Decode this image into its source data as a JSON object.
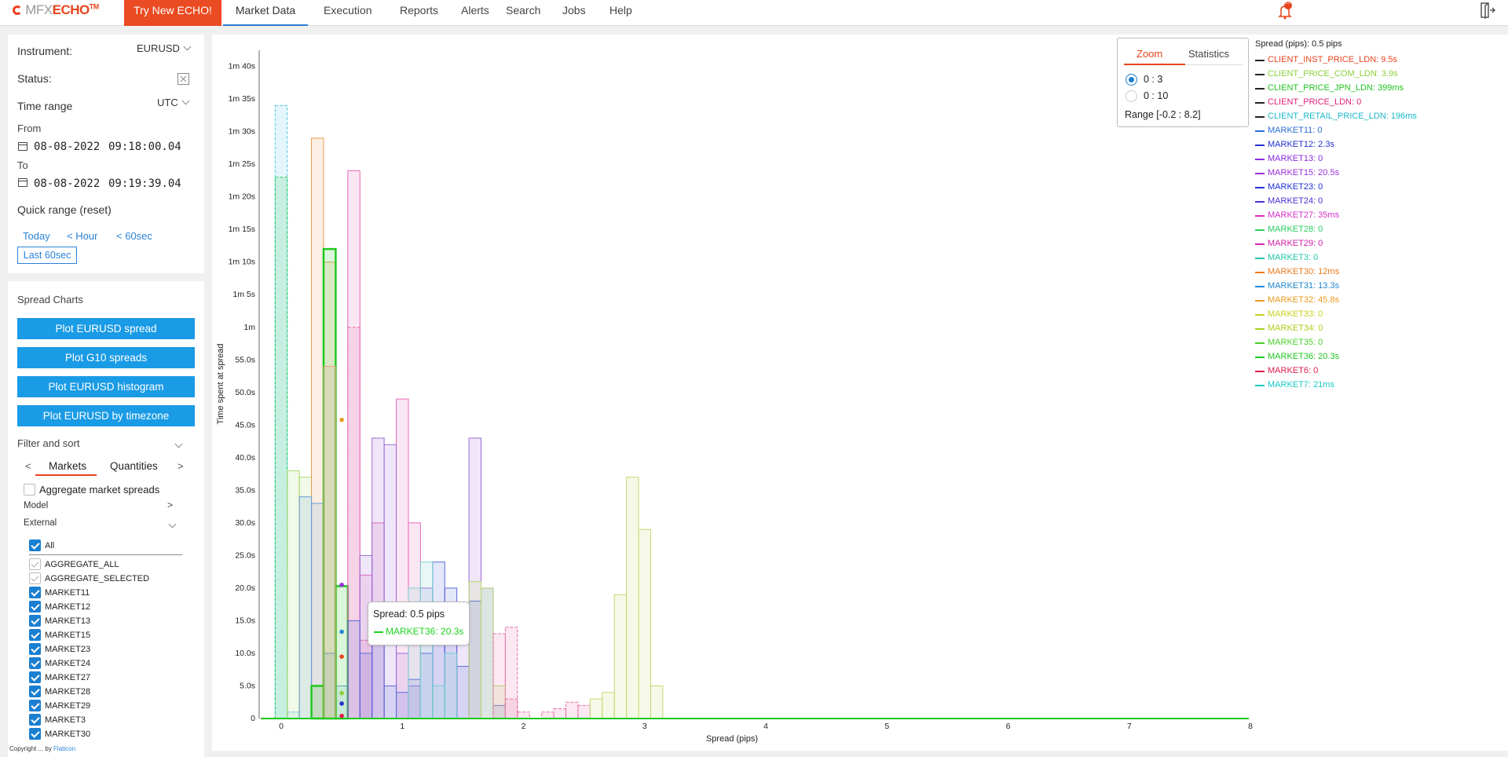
{
  "brand": {
    "mfx": "MFX",
    "echo": "ECHO",
    "tm": "TM"
  },
  "nav": {
    "try_new": "Try New ECHO!",
    "items": [
      "Market Data",
      "Execution",
      "Reports",
      "Alerts",
      "Search",
      "Jobs",
      "Help"
    ],
    "active": "Market Data",
    "notifications": "10+"
  },
  "filters": {
    "instrument_label": "Instrument:",
    "instrument_value": "EURUSD",
    "status_label": "Status:",
    "time_range_label": "Time range",
    "timezone": "UTC",
    "from_label": "From",
    "from_date": "08-08-2022",
    "from_time": "09:18:00.04",
    "to_label": "To",
    "to_date": "08-08-2022",
    "to_time": "09:19:39.04",
    "quick_range_label": "Quick range (reset)",
    "quick": {
      "today": "Today",
      "hour": "Hour",
      "sec60": "60sec",
      "last60": "Last 60sec"
    }
  },
  "spread_charts": {
    "title": "Spread Charts",
    "buttons": [
      "Plot EURUSD spread",
      "Plot G10 spreads",
      "Plot EURUSD histogram",
      "Plot EURUSD by timezone"
    ],
    "filter_sort": "Filter and sort",
    "tabs": [
      "Markets",
      "Quantities"
    ],
    "aggregate_label": "Aggregate market spreads",
    "model_label": "Model",
    "external_label": "External",
    "all_label": "All",
    "markets": [
      {
        "name": "AGGREGATE_ALL",
        "state": "grey"
      },
      {
        "name": "AGGREGATE_SELECTED",
        "state": "grey"
      },
      {
        "name": "MARKET11",
        "state": "on"
      },
      {
        "name": "MARKET12",
        "state": "on"
      },
      {
        "name": "MARKET13",
        "state": "on"
      },
      {
        "name": "MARKET15",
        "state": "on"
      },
      {
        "name": "MARKET23",
        "state": "on"
      },
      {
        "name": "MARKET24",
        "state": "on"
      },
      {
        "name": "MARKET27",
        "state": "on"
      },
      {
        "name": "MARKET28",
        "state": "on"
      },
      {
        "name": "MARKET29",
        "state": "on"
      },
      {
        "name": "MARKET3",
        "state": "on"
      },
      {
        "name": "MARKET30",
        "state": "on"
      }
    ]
  },
  "zoom": {
    "tab_zoom": "Zoom",
    "tab_stats": "Statistics",
    "option1": "0 : 3",
    "option2": "0 : 10",
    "range": "Range [-0.2 : 8.2]"
  },
  "tooltip": {
    "spread": "Spread: 0.5 pips",
    "series": "MARKET36: 20.3s",
    "color": "#1ed21e"
  },
  "legend": {
    "header": "Spread (pips): 0.5 pips",
    "items": [
      {
        "label": "CLIENT_INST_PRICE_LDN: 9.5s",
        "color": "#e8431c",
        "dashed": true
      },
      {
        "label": "CLIENT_PRICE_COM_LDN: 3.9s",
        "color": "#8bd03a",
        "dashed": true
      },
      {
        "label": "CLIENT_PRICE_JPN_LDN: 399ms",
        "color": "#22c422",
        "dashed": true
      },
      {
        "label": "CLIENT_PRICE_LDN: 0",
        "color": "#e0207a",
        "dashed": true
      },
      {
        "label": "CLIENT_RETAIL_PRICE_LDN: 196ms",
        "color": "#1ab8c8",
        "dashed": true
      },
      {
        "label": "MARKET11: 0",
        "color": "#2b6fd4",
        "dashed": false
      },
      {
        "label": "MARKET12: 2.3s",
        "color": "#2233cc",
        "dashed": false
      },
      {
        "label": "MARKET13: 0",
        "color": "#8a2be2",
        "dashed": false
      },
      {
        "label": "MARKET15: 20.5s",
        "color": "#9b2fd8",
        "dashed": false
      },
      {
        "label": "MARKET23: 0",
        "color": "#1f2fdd",
        "dashed": false
      },
      {
        "label": "MARKET24: 0",
        "color": "#4b2fd8",
        "dashed": false
      },
      {
        "label": "MARKET27: 35ms",
        "color": "#d62fc8",
        "dashed": false
      },
      {
        "label": "MARKET28: 0",
        "color": "#2ad060",
        "dashed": false
      },
      {
        "label": "MARKET29: 0",
        "color": "#d41fa8",
        "dashed": false
      },
      {
        "label": "MARKET3: 0",
        "color": "#20c8a8",
        "dashed": false
      },
      {
        "label": "MARKET30: 12ms",
        "color": "#e87a1c",
        "dashed": false
      },
      {
        "label": "MARKET31: 13.3s",
        "color": "#2288d0",
        "dashed": false
      },
      {
        "label": "MARKET32: 45.8s",
        "color": "#e89a1c",
        "dashed": false
      },
      {
        "label": "MARKET33: 0",
        "color": "#c8d01c",
        "dashed": false
      },
      {
        "label": "MARKET34: 0",
        "color": "#a8d01c",
        "dashed": false
      },
      {
        "label": "MARKET35: 0",
        "color": "#4ad02a",
        "dashed": false
      },
      {
        "label": "MARKET36: 20.3s",
        "color": "#1ec81e",
        "dashed": false
      },
      {
        "label": "MARKET6: 0",
        "color": "#e01c4a",
        "dashed": false
      },
      {
        "label": "MARKET7: 21ms",
        "color": "#1ac8c8",
        "dashed": false
      }
    ]
  },
  "chart_data": {
    "type": "bar",
    "xlabel": "Spread (pips)",
    "ylabel": "Time spent at spread",
    "xlim": [
      -0.2,
      8.2
    ],
    "ylim": [
      0,
      102
    ],
    "x_ticks": [
      0,
      1,
      2,
      3,
      4,
      5,
      6,
      7,
      8
    ],
    "y_ticks": [
      {
        "v": 0,
        "label": "0"
      },
      {
        "v": 5,
        "label": "5.0s"
      },
      {
        "v": 10,
        "label": "10.0s"
      },
      {
        "v": 15,
        "label": "15.0s"
      },
      {
        "v": 20,
        "label": "20.0s"
      },
      {
        "v": 25,
        "label": "25.0s"
      },
      {
        "v": 30,
        "label": "30.0s"
      },
      {
        "v": 35,
        "label": "35.0s"
      },
      {
        "v": 40,
        "label": "40.0s"
      },
      {
        "v": 45,
        "label": "45.0s"
      },
      {
        "v": 50,
        "label": "50.0s"
      },
      {
        "v": 55,
        "label": "55.0s"
      },
      {
        "v": 60,
        "label": "1m"
      },
      {
        "v": 65,
        "label": "1m 5s"
      },
      {
        "v": 70,
        "label": "1m 10s"
      },
      {
        "v": 75,
        "label": "1m 15s"
      },
      {
        "v": 80,
        "label": "1m 20s"
      },
      {
        "v": 85,
        "label": "1m 25s"
      },
      {
        "v": 90,
        "label": "1m 30s"
      },
      {
        "v": 95,
        "label": "1m 35s"
      },
      {
        "v": 100,
        "label": "1m 40s"
      }
    ],
    "bin_width": 0.1,
    "series": [
      {
        "name": "CLIENT_RETAIL_PRICE_LDN",
        "color": "#5ac8e8",
        "dashed": true,
        "x": [
          0.0,
          0.1
        ],
        "values": [
          94,
          1
        ]
      },
      {
        "name": "CLIENT_PRICE_JPN_LDN",
        "color": "#2ad060",
        "dashed": true,
        "x": [
          0.0
        ],
        "values": [
          83
        ]
      },
      {
        "name": "CLIENT_PRICE_COM_LDN",
        "color": "#a8d870",
        "dashed": false,
        "x": [
          0.1,
          0.2
        ],
        "values": [
          38,
          37
        ]
      },
      {
        "name": "MARKET32",
        "color": "#e89a50",
        "dashed": false,
        "x": [
          0.3,
          0.4
        ],
        "values": [
          89,
          70
        ]
      },
      {
        "name": "MARKET31",
        "color": "#6a9ad8",
        "dashed": false,
        "x": [
          0.2,
          0.3,
          0.4,
          0.5
        ],
        "values": [
          34,
          33,
          10,
          5
        ]
      },
      {
        "name": "MARKET36",
        "color": "#1ec81e",
        "dashed": false,
        "x": [
          0.3,
          0.4,
          0.5
        ],
        "values": [
          5,
          72,
          20.3
        ]
      },
      {
        "name": "CLIENT_INST_PRICE_LDN",
        "color": "#e8a080",
        "dashed": false,
        "x": [
          0.4
        ],
        "values": [
          54
        ]
      },
      {
        "name": "CLIENT_PRICE_LDN",
        "color": "#e870a8",
        "dashed": true,
        "x": [
          0.6,
          0.7,
          1.9
        ],
        "values": [
          60,
          12,
          14
        ]
      },
      {
        "name": "MARKET27",
        "color": "#e86ab8",
        "dashed": false,
        "x": [
          0.6,
          0.7,
          0.8,
          1.0,
          1.1
        ],
        "values": [
          84,
          22,
          30,
          49,
          30
        ]
      },
      {
        "name": "MARKET15",
        "color": "#9b6ad8",
        "dashed": false,
        "x": [
          0.7,
          0.8,
          0.9,
          1.0,
          1.1,
          1.2,
          1.3,
          1.4,
          1.5,
          1.6
        ],
        "values": [
          25,
          43,
          42,
          10,
          5,
          20,
          17,
          13,
          12,
          43
        ]
      },
      {
        "name": "MARKET12",
        "color": "#5a6ad8",
        "dashed": false,
        "x": [
          0.6,
          0.7,
          0.8,
          0.9,
          1.0,
          1.1,
          1.2,
          1.3,
          1.4,
          1.5,
          1.6,
          1.7,
          1.8
        ],
        "values": [
          15,
          10,
          15,
          5,
          4,
          6,
          10,
          24,
          20,
          8,
          18,
          20,
          2
        ]
      },
      {
        "name": "MARKET7",
        "color": "#7ad0d0",
        "dashed": false,
        "x": [
          1.1,
          1.2,
          1.3,
          1.4
        ],
        "values": [
          20,
          24,
          5,
          10
        ]
      },
      {
        "name": "MARKET34",
        "color": "#b8d870",
        "dashed": false,
        "x": [
          1.6,
          1.7,
          1.8
        ],
        "values": [
          21,
          20,
          5
        ]
      },
      {
        "name": "MARKET29",
        "color": "#e870a8",
        "dashed": true,
        "x": [
          1.8,
          1.9,
          2.0,
          2.2,
          2.3,
          2.4,
          2.5
        ],
        "values": [
          13,
          3,
          1,
          1,
          1.5,
          2.5,
          2
        ]
      },
      {
        "name": "MARKET33",
        "color": "#c8d870",
        "dashed": false,
        "x": [
          2.6,
          2.7,
          2.8,
          2.9,
          3.0,
          3.1
        ],
        "values": [
          3,
          4,
          19,
          37,
          29,
          5
        ]
      }
    ],
    "hover_points": [
      {
        "x": 0.5,
        "value": 20.5,
        "color": "#9b2fd8"
      },
      {
        "x": 0.5,
        "value": 13.3,
        "color": "#2288d0"
      },
      {
        "x": 0.5,
        "value": 9.5,
        "color": "#e8431c"
      },
      {
        "x": 0.5,
        "value": 3.9,
        "color": "#8bd03a"
      },
      {
        "x": 0.5,
        "value": 2.3,
        "color": "#2233cc"
      },
      {
        "x": 0.5,
        "value": 45.8,
        "color": "#e89a1c"
      },
      {
        "x": 0.5,
        "value": 0.4,
        "color": "#e01c4a"
      }
    ]
  },
  "footer": {
    "text": "Copyright",
    "link": "Flaticon"
  }
}
